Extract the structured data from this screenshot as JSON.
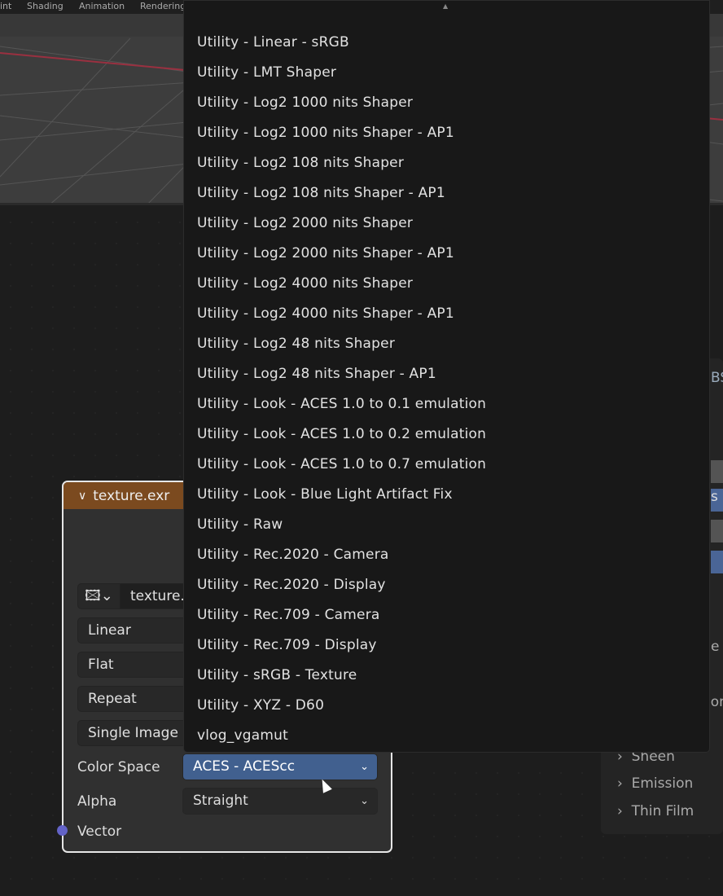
{
  "topbar": {
    "tabs": [
      "int",
      "Shading",
      "Animation",
      "Rendering"
    ]
  },
  "node": {
    "title": "texture.exr",
    "image_name": "texture.",
    "interpolation": "Linear",
    "projection": "Flat",
    "extension": "Repeat",
    "source": "Single Image",
    "color_space_label": "Color Space",
    "color_space_value": "ACES - ACEScc",
    "alpha_label": "Alpha",
    "alpha_value": "Straight",
    "vector_label": "Vector",
    "header_color": "#7b4a1f",
    "socket_color": "#6363c7"
  },
  "menu": {
    "scroll_up": "▲",
    "items": [
      "Utility - Linear - sRGB",
      "Utility - LMT Shaper",
      "Utility - Log2 1000 nits Shaper",
      "Utility - Log2 1000 nits Shaper - AP1",
      "Utility - Log2 108 nits Shaper",
      "Utility - Log2 108 nits Shaper - AP1",
      "Utility - Log2 2000 nits Shaper",
      "Utility - Log2 2000 nits Shaper - AP1",
      "Utility - Log2 4000 nits Shaper",
      "Utility - Log2 4000 nits Shaper - AP1",
      "Utility - Log2 48 nits Shaper",
      "Utility - Log2 48 nits Shaper - AP1",
      "Utility - Look - ACES 1.0 to 0.1 emulation",
      "Utility - Look - ACES 1.0 to 0.2 emulation",
      "Utility - Look - ACES 1.0 to 0.7 emulation",
      "Utility - Look - Blue Light Artifact Fix",
      "Utility - Raw",
      "Utility - Rec.2020 - Camera",
      "Utility - Rec.2020 - Display",
      "Utility - Rec.709 - Camera",
      "Utility - Rec.709 - Display",
      "Utility - sRGB - Texture",
      "Utility - XYZ - D60",
      "vlog_vgamut"
    ]
  },
  "side": {
    "partial": [
      "BS",
      "s",
      "e",
      "ion"
    ],
    "items": [
      "Sheen",
      "Emission",
      "Thin Film"
    ]
  },
  "colors": {
    "accent": "#41608f"
  }
}
